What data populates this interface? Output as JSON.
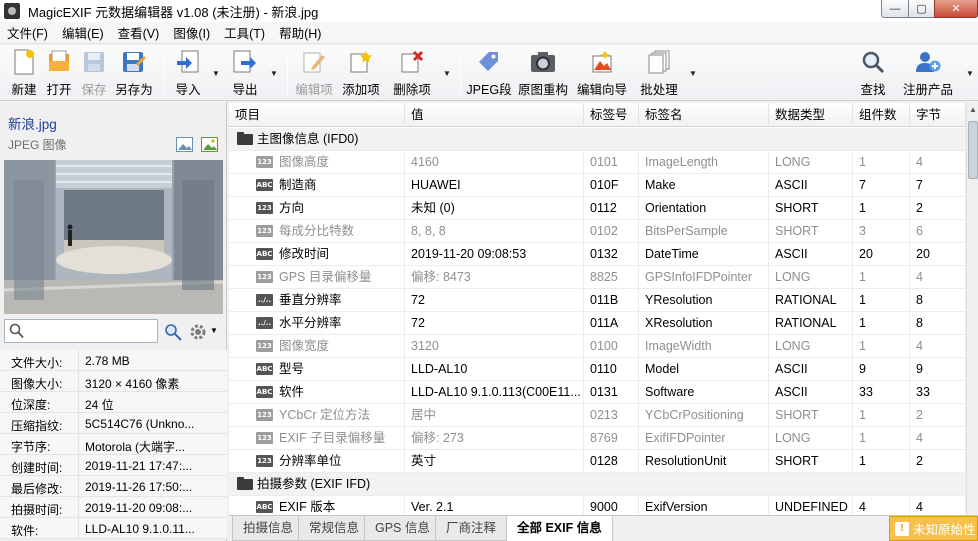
{
  "window": {
    "title": "MagicEXIF 元数据编辑器 v1.08 (未注册) - 新浪.jpg",
    "min": "—",
    "max": "▢",
    "close": "✕"
  },
  "menu": [
    "文件(F)",
    "编辑(E)",
    "查看(V)",
    "图像(I)",
    "工具(T)",
    "帮助(H)"
  ],
  "toolbar": {
    "new": "新建",
    "open": "打开",
    "save": "保存",
    "saveas": "另存为",
    "import": "导入",
    "export": "导出",
    "edit_item": "编辑项",
    "add_item": "添加项",
    "delete_item": "删除项",
    "jpeg_seg": "JPEG段",
    "reconstruct": "原图重构",
    "wizard": "编辑向导",
    "batch": "批处理",
    "find": "查找",
    "register": "注册产品"
  },
  "sidebar": {
    "filename": "新浪.jpg",
    "filetype": "JPEG 图像",
    "search_placeholder": "",
    "props": [
      {
        "k": "文件大小:",
        "v": "2.78 MB"
      },
      {
        "k": "图像大小:",
        "v": "3120 × 4160 像素"
      },
      {
        "k": "位深度:",
        "v": "24 位"
      },
      {
        "k": "压缩指纹:",
        "v": "5C514C76 (Unkno..."
      },
      {
        "k": "字节序:",
        "v": "Motorola (大端字..."
      },
      {
        "k": "创建时间:",
        "v": "2019-11-21 17:47:..."
      },
      {
        "k": "最后修改:",
        "v": "2019-11-26 17:50:..."
      },
      {
        "k": "拍摄时间:",
        "v": "2019-11-20 09:08:..."
      },
      {
        "k": "软件:",
        "v": "LLD-AL10 9.1.0.11..."
      }
    ]
  },
  "table": {
    "headers": [
      "项目",
      "值",
      "标签号",
      "标签名",
      "数据类型",
      "组件数",
      "字节"
    ],
    "rows": [
      {
        "group": true,
        "name": "主图像信息 (IFD0)"
      },
      {
        "gray": true,
        "tag": "123",
        "name": "图像高度",
        "value": "4160",
        "id": "0101",
        "tagname": "ImageLength",
        "type": "LONG",
        "count": "1",
        "bytes": "4"
      },
      {
        "tag": "ABC",
        "name": "制造商",
        "value": "HUAWEI",
        "id": "010F",
        "tagname": "Make",
        "type": "ASCII",
        "count": "7",
        "bytes": "7"
      },
      {
        "tag": "123",
        "name": "方向",
        "value": "未知 (0)",
        "id": "0112",
        "tagname": "Orientation",
        "type": "SHORT",
        "count": "1",
        "bytes": "2"
      },
      {
        "gray": true,
        "tag": "123",
        "name": "每成分比特数",
        "value": "8, 8, 8",
        "id": "0102",
        "tagname": "BitsPerSample",
        "type": "SHORT",
        "count": "3",
        "bytes": "6"
      },
      {
        "tag": "ABC",
        "name": "修改时间",
        "value": "2019-11-20 09:08:53",
        "id": "0132",
        "tagname": "DateTime",
        "type": "ASCII",
        "count": "20",
        "bytes": "20"
      },
      {
        "gray": true,
        "tag": "123",
        "name": "GPS 目录偏移量",
        "value": "偏移: 8473",
        "id": "8825",
        "tagname": "GPSInfoIFDPointer",
        "type": "LONG",
        "count": "1",
        "bytes": "4"
      },
      {
        "tag": "../..",
        "name": "垂直分辨率",
        "value": "72",
        "id": "011B",
        "tagname": "YResolution",
        "type": "RATIONAL",
        "count": "1",
        "bytes": "8"
      },
      {
        "tag": "../..",
        "name": "水平分辨率",
        "value": "72",
        "id": "011A",
        "tagname": "XResolution",
        "type": "RATIONAL",
        "count": "1",
        "bytes": "8"
      },
      {
        "gray": true,
        "tag": "123",
        "name": "图像宽度",
        "value": "3120",
        "id": "0100",
        "tagname": "ImageWidth",
        "type": "LONG",
        "count": "1",
        "bytes": "4"
      },
      {
        "tag": "ABC",
        "name": "型号",
        "value": "LLD-AL10",
        "id": "0110",
        "tagname": "Model",
        "type": "ASCII",
        "count": "9",
        "bytes": "9"
      },
      {
        "tag": "ABC",
        "name": "软件",
        "value": "LLD-AL10 9.1.0.113(C00E11...",
        "id": "0131",
        "tagname": "Software",
        "type": "ASCII",
        "count": "33",
        "bytes": "33"
      },
      {
        "gray": true,
        "tag": "123",
        "name": "YCbCr 定位方法",
        "value": "居中",
        "id": "0213",
        "tagname": "YCbCrPositioning",
        "type": "SHORT",
        "count": "1",
        "bytes": "2"
      },
      {
        "gray": true,
        "tag": "123",
        "name": "EXIF 子目录偏移量",
        "value": "偏移: 273",
        "id": "8769",
        "tagname": "ExifIFDPointer",
        "type": "LONG",
        "count": "1",
        "bytes": "4"
      },
      {
        "tag": "123",
        "name": "分辨率单位",
        "value": "英寸",
        "id": "0128",
        "tagname": "ResolutionUnit",
        "type": "SHORT",
        "count": "1",
        "bytes": "2"
      },
      {
        "group": true,
        "name": "拍摄参数 (EXIF IFD)"
      },
      {
        "tag": "ABC",
        "name": "EXIF 版本",
        "value": "Ver. 2.1",
        "id": "9000",
        "tagname": "ExifVersion",
        "type": "UNDEFINED",
        "count": "4",
        "bytes": "4"
      }
    ]
  },
  "tabs": [
    "拍摄信息",
    "常规信息",
    "GPS 信息",
    "厂商注释",
    "全部 EXIF 信息"
  ],
  "active_tab": "全部 EXIF 信息",
  "warning": "未知原始性"
}
